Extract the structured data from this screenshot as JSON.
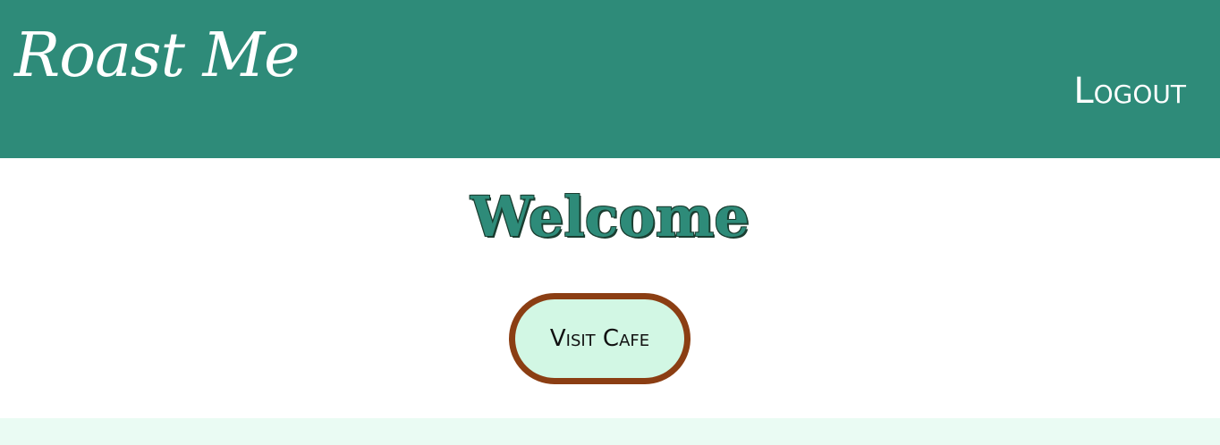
{
  "header": {
    "brand": "Roast Me",
    "logout_label": "Logout"
  },
  "main": {
    "heading": "Welcome",
    "visit_cafe_label": "Visit Cafe"
  },
  "colors": {
    "header_bg": "#2e8b79",
    "button_bg": "#d2f7e4",
    "button_border": "#8b3e13",
    "footer_bg": "#eafbf3"
  }
}
